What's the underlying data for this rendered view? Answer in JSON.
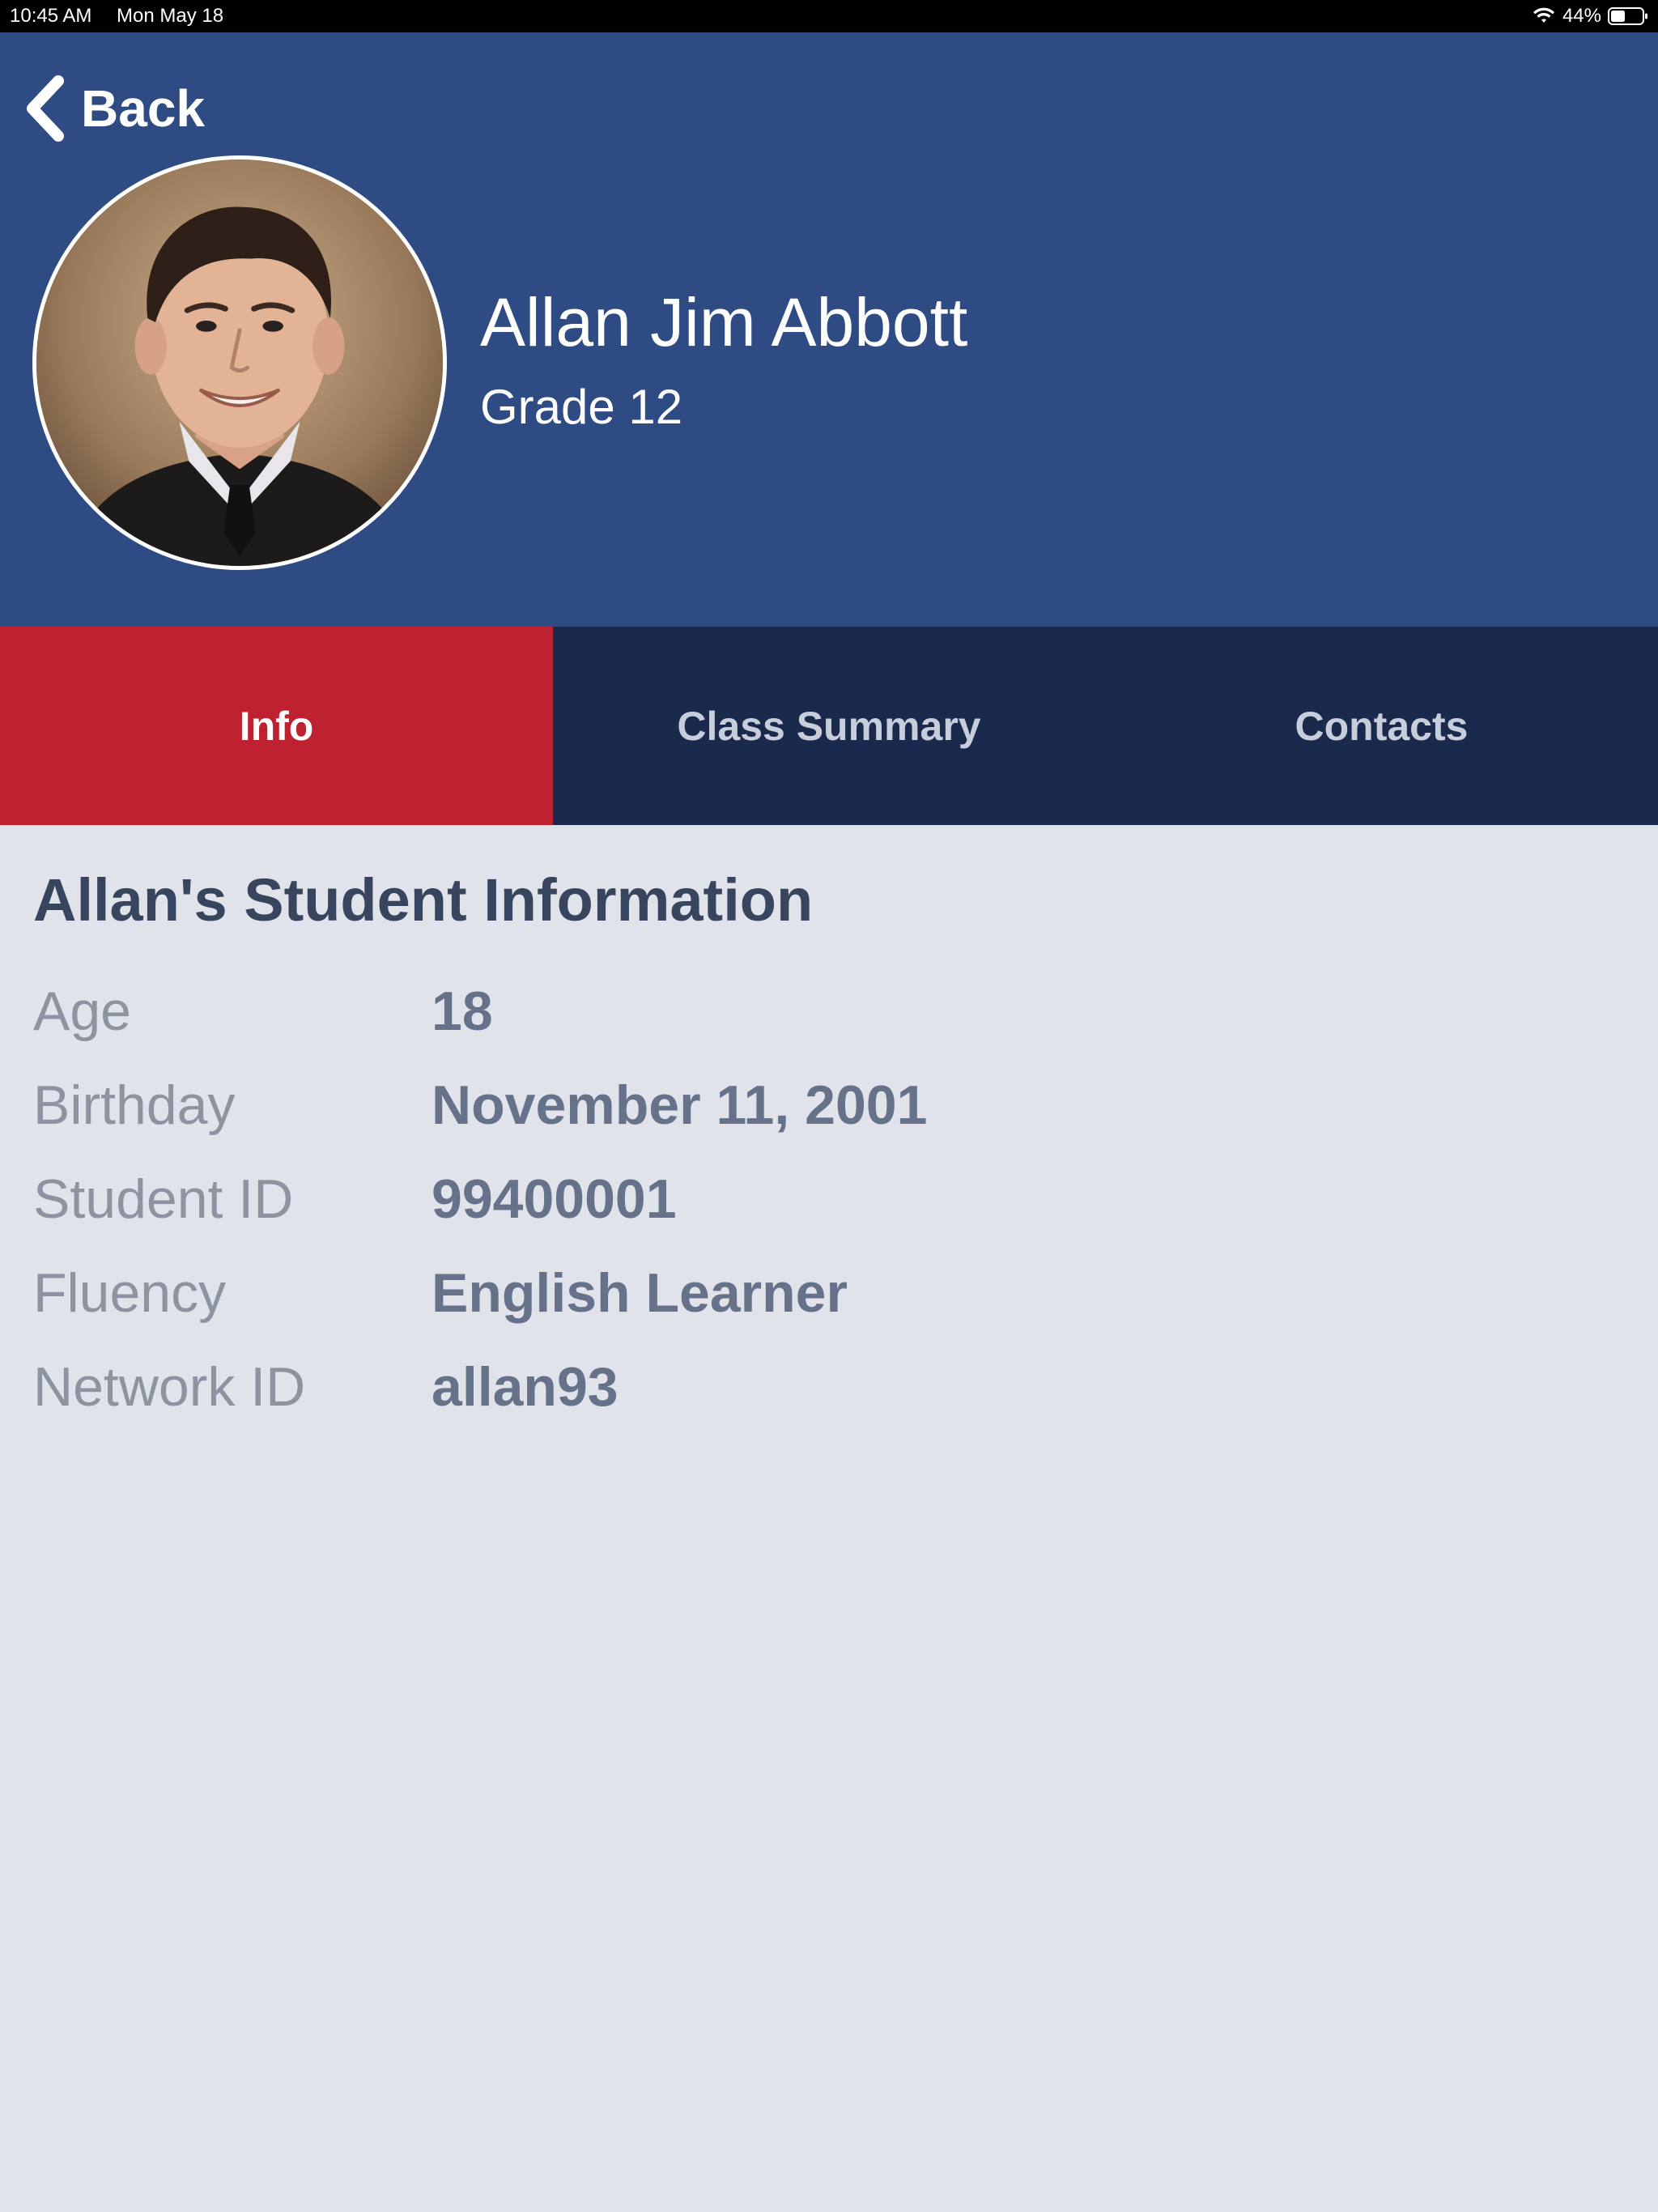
{
  "status_bar": {
    "time": "10:45 AM",
    "date": "Mon May 18",
    "battery": "44%",
    "icons": [
      "wifi-icon",
      "battery-icon"
    ]
  },
  "header": {
    "back_label": "Back",
    "name": "Allan Jim Abbott",
    "grade": "Grade 12",
    "back_icon": "chevron-left-icon"
  },
  "tabs": [
    {
      "label": "Info",
      "active": true
    },
    {
      "label": "Class Summary",
      "active": false
    },
    {
      "label": "Contacts",
      "active": false
    }
  ],
  "info": {
    "title": "Allan's Student Information",
    "rows": [
      {
        "label": "Age",
        "value": "18"
      },
      {
        "label": "Birthday",
        "value": "November 11, 2001"
      },
      {
        "label": "Student ID",
        "value": "99400001"
      },
      {
        "label": "Fluency",
        "value": "English Learner"
      },
      {
        "label": "Network ID",
        "value": "allan93"
      }
    ]
  },
  "colors": {
    "header_bg": "#2f4b83",
    "tab_bar_bg": "#1a2a4d",
    "active_tab": "#be2231",
    "content_bg": "#e1e3ea"
  }
}
